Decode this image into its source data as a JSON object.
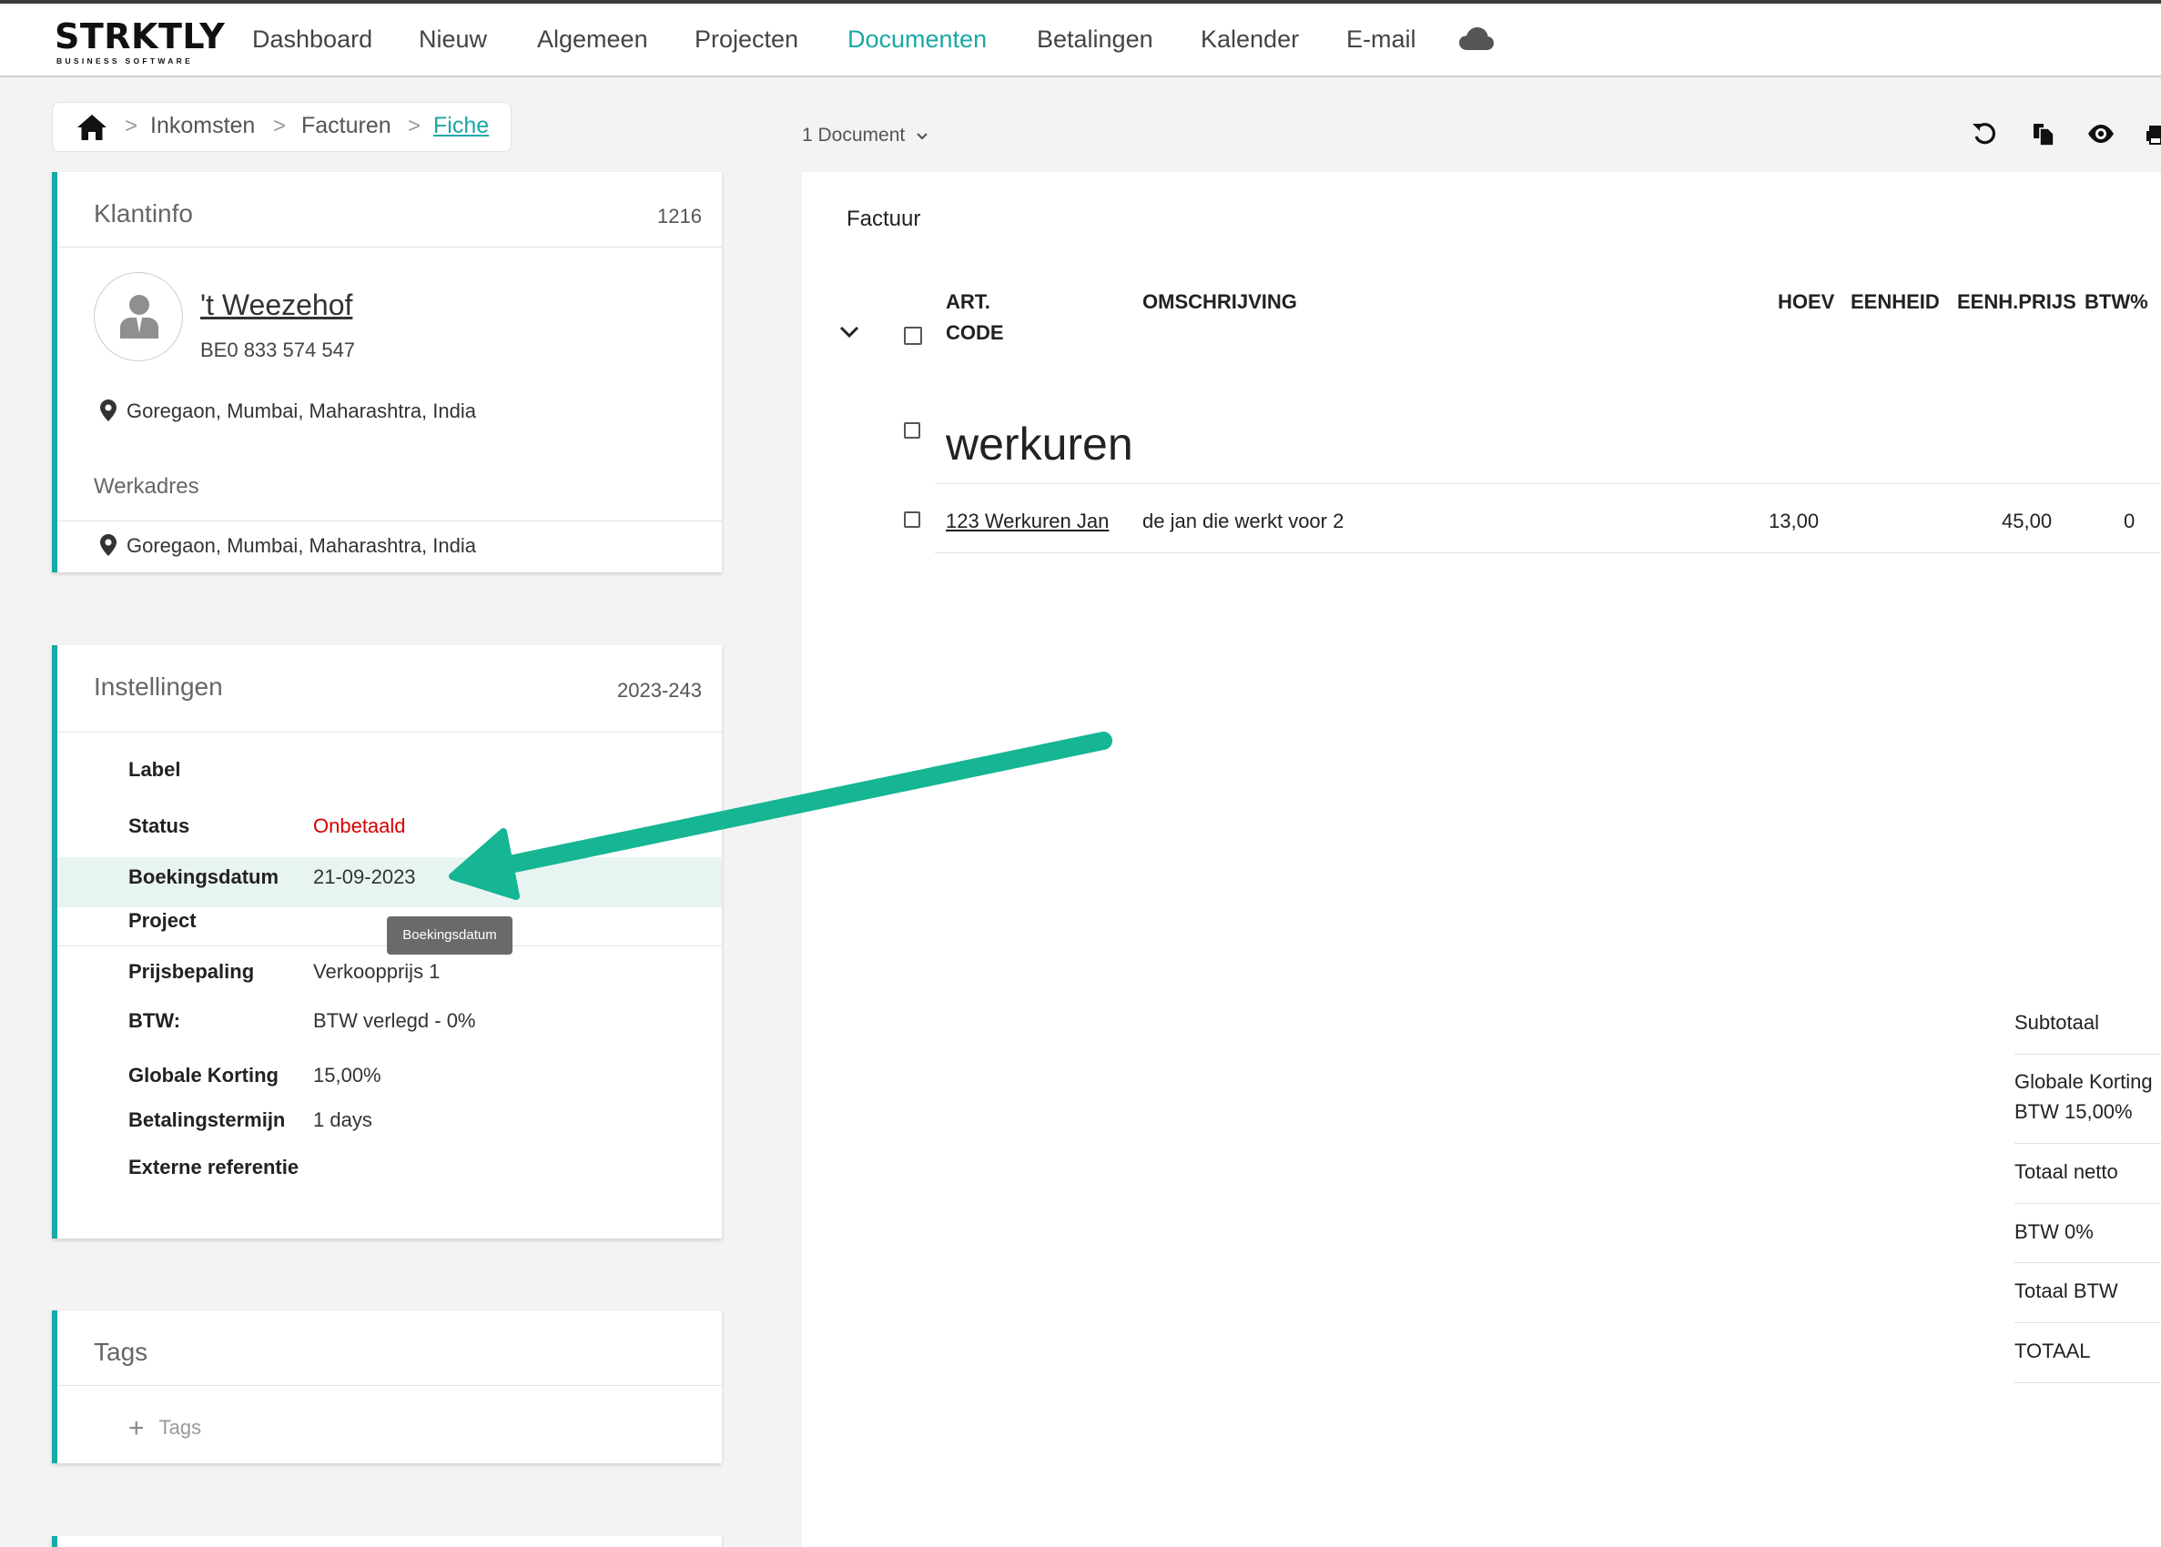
{
  "brand": {
    "name": "STRKTLY",
    "tagline": "BUSINESS SOFTWARE",
    "accent": "#19a8a5"
  },
  "nav": {
    "items": [
      {
        "label": "Dashboard"
      },
      {
        "label": "Nieuw"
      },
      {
        "label": "Algemeen"
      },
      {
        "label": "Projecten"
      },
      {
        "label": "Documenten",
        "active": true
      },
      {
        "label": "Betalingen"
      },
      {
        "label": "Kalender"
      },
      {
        "label": "E-mail"
      }
    ],
    "cloud_icon": "cloud-icon"
  },
  "breadcrumb": {
    "home_icon": "home-icon",
    "items": [
      "Inkomsten",
      "Facturen",
      "Fiche"
    ],
    "separator": ">"
  },
  "client": {
    "title": "Klantinfo",
    "number": "1216",
    "name": "'t Weezehof",
    "vat": "BE0 833 574 547",
    "address": "Goregaon, Mumbai, Maharashtra, India",
    "work_title": "Werkadres",
    "work_address": "Goregaon, Mumbai, Maharashtra, India"
  },
  "settings": {
    "title": "Instellingen",
    "number": "2023-243",
    "rows": [
      {
        "label": "Label",
        "value": ""
      },
      {
        "label": "Status",
        "value": "Onbetaald",
        "value_color": "#d60000"
      },
      {
        "label": "Boekingsdatum",
        "value": "21-09-2023"
      },
      {
        "label": "Project",
        "value": ""
      },
      {
        "label": "Prijsbepaling",
        "value": "Verkoopprijs 1"
      },
      {
        "label": "BTW:",
        "value": "BTW verlegd - 0%"
      },
      {
        "label": "Globale Korting",
        "value": "15,00%"
      },
      {
        "label": "Betalingstermijn",
        "value": "1 days"
      },
      {
        "label": "Externe referentie",
        "value": ""
      }
    ],
    "tooltip": "Boekingsdatum",
    "highlight_color": "#e8f4f1"
  },
  "tags": {
    "title": "Tags",
    "add_label": "Tags"
  },
  "document": {
    "selector": "1 Document",
    "toolbar_icons": [
      "undo-icon",
      "copy-icon",
      "eye-icon",
      "print-icon"
    ],
    "type": "Factuur",
    "columns": {
      "art_code_line1": "ART.",
      "art_code_line2": "CODE",
      "description": "OMSCHRIJVING",
      "quantity": "HOEV",
      "unit": "EENHEID",
      "unit_price": "EENH.PRIJS",
      "vat_pct": "BTW%"
    },
    "section": "werkuren",
    "lines": [
      {
        "art_code": "123 Werkuren Jan",
        "description": "de jan die werkt voor 2",
        "quantity": "13,00",
        "unit": "",
        "unit_price": "45,00",
        "vat_pct": "0"
      }
    ],
    "totals": [
      {
        "label": "Subtotaal"
      },
      {
        "label": "Globale Korting",
        "label2": "BTW 15,00%"
      },
      {
        "label": "Totaal netto"
      },
      {
        "label": "BTW 0%"
      },
      {
        "label": "Totaal BTW"
      },
      {
        "label": "TOTAAL"
      }
    ]
  },
  "annotation": {
    "color": "#16b593"
  }
}
